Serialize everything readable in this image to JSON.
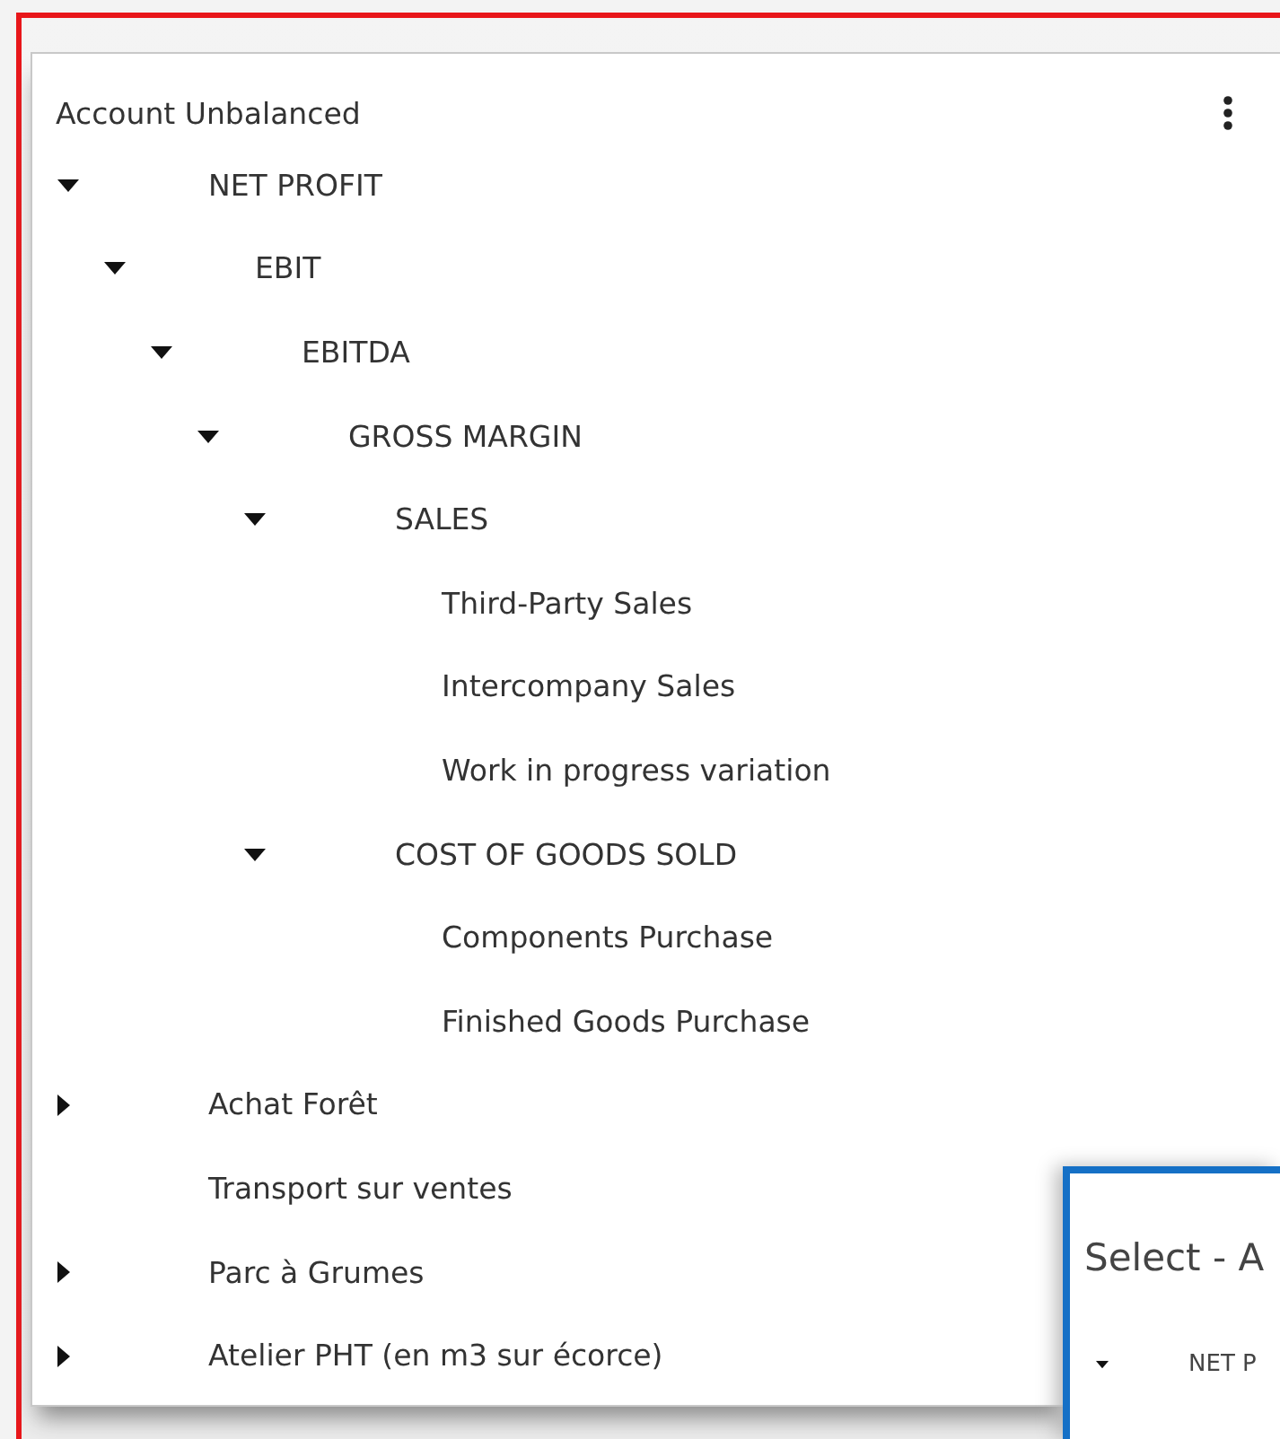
{
  "panel": {
    "title": "Account Unbalanced",
    "tree": [
      {
        "label": "NET PROFIT",
        "expanded": true,
        "children": [
          {
            "label": "EBIT",
            "expanded": true,
            "children": [
              {
                "label": "EBITDA",
                "expanded": true,
                "children": [
                  {
                    "label": "GROSS MARGIN",
                    "expanded": true,
                    "children": [
                      {
                        "label": "SALES",
                        "expanded": true,
                        "children": [
                          {
                            "label": "Third-Party Sales"
                          },
                          {
                            "label": "Intercompany Sales"
                          },
                          {
                            "label": "Work in progress variation"
                          }
                        ]
                      },
                      {
                        "label": "COST OF GOODS SOLD",
                        "expanded": true,
                        "children": [
                          {
                            "label": "Components Purchase"
                          },
                          {
                            "label": "Finished Goods Purchase"
                          }
                        ]
                      }
                    ]
                  }
                ]
              }
            ]
          }
        ]
      },
      {
        "label": "Achat Forêt",
        "expanded": false
      },
      {
        "label": "Transport sur ventes"
      },
      {
        "label": "Parc à Grumes",
        "expanded": false
      },
      {
        "label": "Atelier PHT (en m3 sur écorce)",
        "expanded": false
      }
    ]
  },
  "dialog": {
    "title": "Select - A",
    "tree": [
      {
        "label": "NET P",
        "expanded": true
      }
    ]
  }
}
